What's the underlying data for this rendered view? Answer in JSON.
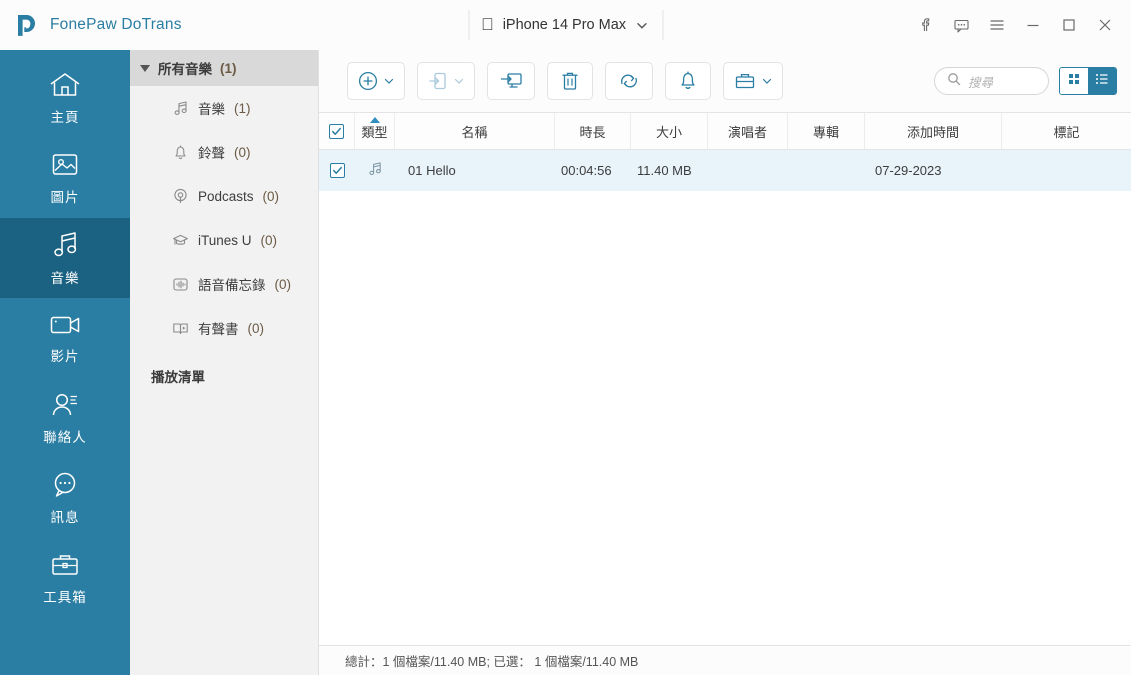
{
  "app": {
    "brand": "FonePaw DoTrans",
    "brand_color": "#2a7da3",
    "accent_color": "#2a7da3",
    "accent_dark": "#1b6182",
    "row_selected_color": "#e8f4fa"
  },
  "titlebar": {
    "device": "iPhone 14 Pro Max",
    "device_dropdown_icon": "chevron-down-icon",
    "apple_icon": "apple-logo-icon",
    "controls": [
      {
        "name": "facebook-button",
        "icon": "facebook-icon"
      },
      {
        "name": "feedback-button",
        "icon": "chat-bubble-icon"
      },
      {
        "name": "menu-button",
        "icon": "hamburger-menu-icon"
      },
      {
        "name": "minimize-button",
        "icon": "minimize-icon"
      },
      {
        "name": "maximize-button",
        "icon": "maximize-icon"
      },
      {
        "name": "close-button",
        "icon": "close-icon"
      }
    ]
  },
  "rail": {
    "items": [
      {
        "label": "主頁",
        "icon": "home-icon",
        "active": false
      },
      {
        "label": "圖片",
        "icon": "photo-icon",
        "active": false
      },
      {
        "label": "音樂",
        "icon": "music-note-icon",
        "active": true
      },
      {
        "label": "影片",
        "icon": "video-camera-icon",
        "active": false
      },
      {
        "label": "聯絡人",
        "icon": "contacts-icon",
        "active": false
      },
      {
        "label": "訊息",
        "icon": "message-icon",
        "active": false
      },
      {
        "label": "工具箱",
        "icon": "toolbox-icon",
        "active": false
      }
    ]
  },
  "subnav": {
    "header": {
      "label": "所有音樂",
      "count": "(1)"
    },
    "items": [
      {
        "label": "音樂",
        "count": "(1)",
        "icon": "music-note-icon"
      },
      {
        "label": "鈴聲",
        "count": "(0)",
        "icon": "bell-icon"
      },
      {
        "label": "Podcasts",
        "count": "(0)",
        "icon": "podcast-icon"
      },
      {
        "label": "iTunes U",
        "count": "(0)",
        "icon": "graduation-cap-icon"
      },
      {
        "label": "語音備忘錄",
        "count": "(0)",
        "icon": "waveform-icon"
      },
      {
        "label": "有聲書",
        "count": "(0)",
        "icon": "audiobook-icon"
      }
    ],
    "section_label": "播放清單"
  },
  "toolbar": {
    "buttons": [
      {
        "name": "add-button",
        "icon": "plus-circle-icon",
        "dropdown": true,
        "disabled": false
      },
      {
        "name": "export-to-device-button",
        "icon": "export-to-phone-icon",
        "dropdown": true,
        "disabled": true
      },
      {
        "name": "export-to-pc-button",
        "icon": "export-to-computer-icon",
        "dropdown": false,
        "disabled": false
      },
      {
        "name": "delete-button",
        "icon": "trash-icon",
        "dropdown": false,
        "disabled": false
      },
      {
        "name": "refresh-button",
        "icon": "refresh-icon",
        "dropdown": false,
        "disabled": false
      },
      {
        "name": "ringtone-maker-button",
        "icon": "bell-icon",
        "dropdown": false,
        "disabled": false
      },
      {
        "name": "toolbox-button",
        "icon": "toolbox-icon",
        "dropdown": true,
        "disabled": false
      }
    ],
    "search": {
      "placeholder": "搜尋",
      "value": "",
      "icon": "search-icon"
    },
    "view_grid": {
      "icon": "grid-view-icon",
      "active": false
    },
    "view_list": {
      "icon": "list-view-icon",
      "active": true
    }
  },
  "table": {
    "header_checkbox_checked": true,
    "sorted_column": "類型",
    "sort_direction": "asc",
    "columns": [
      {
        "key": "checkbox",
        "label": ""
      },
      {
        "key": "type",
        "label": "類型"
      },
      {
        "key": "name",
        "label": "名稱"
      },
      {
        "key": "duration",
        "label": "時長"
      },
      {
        "key": "size",
        "label": "大小"
      },
      {
        "key": "artist",
        "label": "演唱者"
      },
      {
        "key": "album",
        "label": "專輯"
      },
      {
        "key": "date_added",
        "label": "添加時間"
      },
      {
        "key": "tag",
        "label": "標記"
      }
    ],
    "rows": [
      {
        "checked": true,
        "type_icon": "music-note-icon",
        "name": "01 Hello",
        "duration": "00:04:56",
        "size": "11.40 MB",
        "artist": "",
        "album": "",
        "date_added": "07-29-2023",
        "tag": ""
      }
    ]
  },
  "statusbar": {
    "text": "總計：1 個檔案/11.40 MB; 已選： 1 個檔案/11.40 MB"
  }
}
